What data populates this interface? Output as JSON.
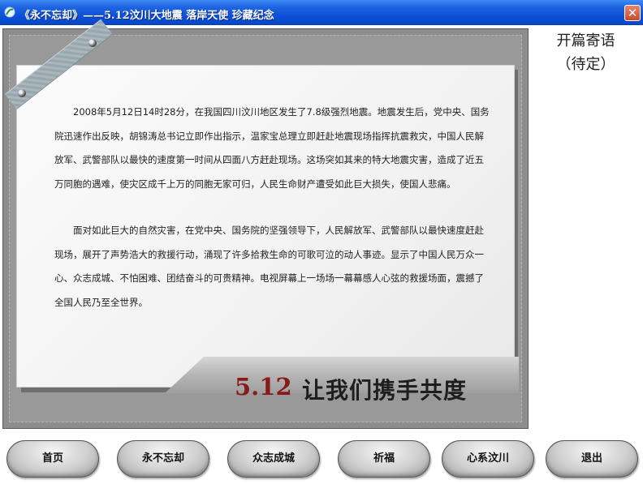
{
  "window": {
    "title": "《永不忘却》——5.12汶川大地震 落岸天使 珍藏纪念",
    "close_glyph": "✕"
  },
  "article": {
    "paragraphs": [
      "2008年5月12日14时28分，在我国四川汶川地区发生了7.8级强烈地震。地震发生后，党中央、国务院迅速作出反映，胡锦涛总书记立即作出指示，温家宝总理立即赶赴地震现场指挥抗震救灾，中国人民解放军、武警部队以最快的速度第一时间从四面八方赶赴现场。这场突如其来的特大地震灾害，造成了近五万同胞的遇难，使灾区成千上万的同胞无家可归，人民生命财产遭受如此巨大损失，使国人悲痛。",
      "面对如此巨大的自然灾害，在党中央、国务院的坚强领导下，人民解放军、武警部队以最快速度赶赴现场，展开了声势浩大的救援行动，涌现了许多拾救生命的可歌可泣的动人事迹。显示了中国人民万众一心、众志成城、不怕困难、团结奋斗的可贵精神。电视屏幕上一场场一幕幕感人心弦的救援场面，震撼了全国人民乃至全世界。"
    ]
  },
  "banner": {
    "number": "5.12",
    "slogan": "让我们携手共度"
  },
  "side_panel": {
    "title": "开篇寄语",
    "subtitle": "（待定）"
  },
  "nav": [
    {
      "label": "首页"
    },
    {
      "label": "永不忘却"
    },
    {
      "label": "众志成城"
    },
    {
      "label": "祈福"
    },
    {
      "label": "心系汶川"
    },
    {
      "label": "退出"
    }
  ]
}
